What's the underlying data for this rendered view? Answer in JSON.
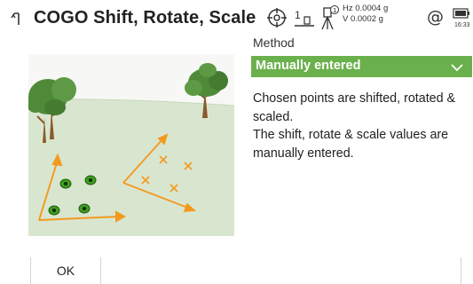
{
  "header": {
    "title": "COGO Shift, Rotate, Scale",
    "tilt_indicator": "1",
    "hz_reading": "Hz 0.0004 g",
    "v_reading": "V  0.0002 g",
    "clock": "16:33"
  },
  "method": {
    "label": "Method",
    "selected": "Manually entered"
  },
  "description": {
    "line1": "Chosen points are shifted, rotated & scaled.",
    "line2": "The shift, rotate & scale values are manually entered."
  },
  "footer": {
    "ok_label": "OK"
  },
  "colors": {
    "accent": "#6ab04c",
    "arrow_orange": "#f29a1f",
    "point_green": "#3e9d1e",
    "field_green": "#d9e6cf",
    "tree_green": "#4f8a39"
  },
  "icons": [
    "back-arrow-icon",
    "target-icon",
    "tilt-sensor-icon",
    "compensator-icon",
    "at-sign-icon",
    "battery-icon",
    "chevron-down-icon"
  ]
}
